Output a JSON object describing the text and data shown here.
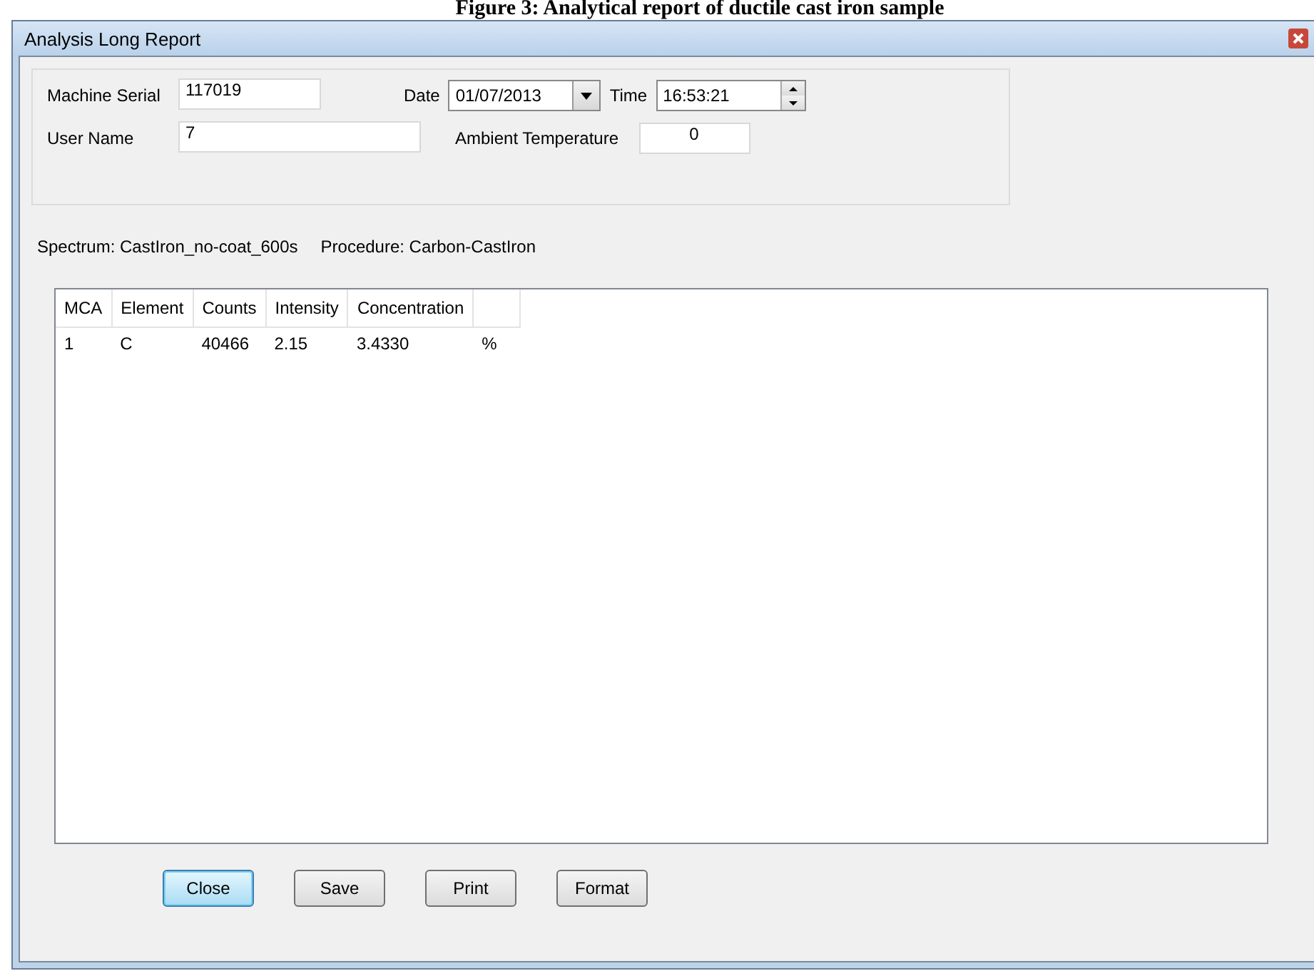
{
  "caption": "Figure 3: Analytical report of ductile cast iron sample",
  "window": {
    "title": "Analysis Long Report"
  },
  "header": {
    "machine_serial": {
      "label": "Machine Serial",
      "value": "117019"
    },
    "date": {
      "label": "Date",
      "value": "01/07/2013"
    },
    "time": {
      "label": "Time",
      "value": "16:53:21"
    },
    "user_name": {
      "label": "User Name",
      "value": "7"
    },
    "ambient_temperature": {
      "label": "Ambient Temperature",
      "value": "0"
    }
  },
  "info": {
    "spectrum": "Spectrum: CastIron_no-coat_600s",
    "procedure": "Procedure: Carbon-CastIron"
  },
  "table": {
    "columns": [
      "MCA",
      "Element",
      "Counts",
      "Intensity",
      "Concentration"
    ],
    "rows": [
      {
        "cells": [
          "1",
          "C",
          "40466",
          "2.15",
          "3.4330",
          "%"
        ]
      }
    ]
  },
  "buttons": [
    {
      "label": "Close",
      "default": true
    },
    {
      "label": "Save",
      "default": false
    },
    {
      "label": "Print",
      "default": false
    },
    {
      "label": "Format",
      "default": false
    }
  ]
}
